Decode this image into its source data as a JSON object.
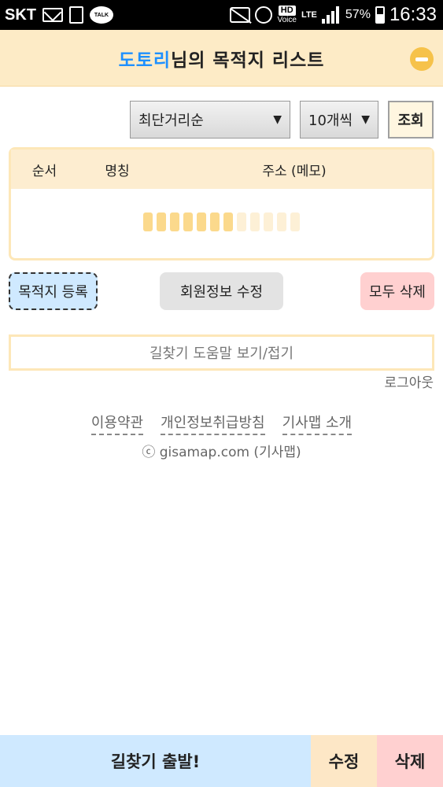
{
  "status_bar": {
    "carrier": "SKT",
    "talk_badge": "TALK",
    "hd_label": "HD",
    "voice_label": "Voice",
    "lte_label": "LTE",
    "battery_percent": "57%",
    "time": "16:33"
  },
  "header": {
    "user_name": "도토리",
    "title_suffix": "님의 목적지 리스트"
  },
  "controls": {
    "sort_value": "최단거리순",
    "count_value": "10개씩",
    "query_label": "조회",
    "arrow": "▼"
  },
  "table": {
    "columns": [
      "순서",
      "명칭",
      "주소 (메모)"
    ]
  },
  "actions": {
    "register_label": "목적지 등록",
    "member_label": "회원정보 수정",
    "delete_all_label": "모두 삭제"
  },
  "help": {
    "label": "길찾기 도움말 보기/접기"
  },
  "logout_label": "로그아웃",
  "footer": {
    "links": [
      "이용약관",
      "개인정보취급방침",
      "기사맵 소개"
    ],
    "copyright": "ⓒ gisamap.com (기사맵)"
  },
  "bottom_bar": {
    "go_label": "길찾기 출발!",
    "edit_label": "수정",
    "delete_label": "삭제"
  },
  "colors": {
    "accent_blue": "#1e90ff",
    "header_bg": "#fdebc6",
    "loader_on": "#fbd98c",
    "loader_off": "#fdf0d6"
  },
  "loader": {
    "active_segments": 7,
    "total_segments": 12
  }
}
